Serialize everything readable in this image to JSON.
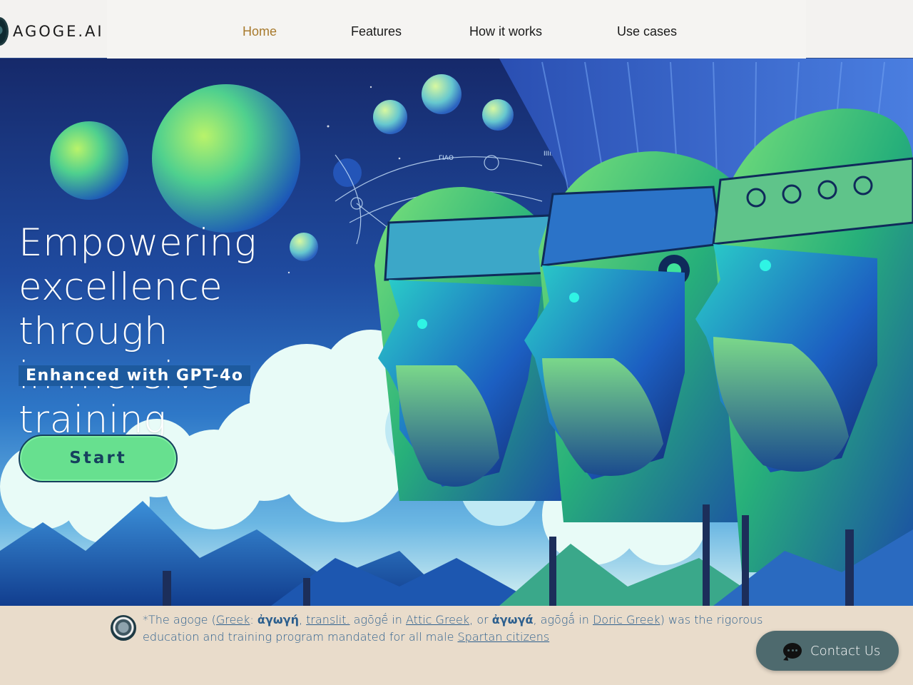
{
  "header": {
    "logo_text": "AGOGE.AI",
    "nav": [
      {
        "label": "Home",
        "active": true
      },
      {
        "label": "Features",
        "active": false
      },
      {
        "label": "How it works",
        "active": false
      },
      {
        "label": "Use cases",
        "active": false
      }
    ]
  },
  "hero": {
    "title": "Empowering excellence through immersive training",
    "badge": "Enhanced with GPT-4o",
    "start_label": "Start",
    "art_labels": [
      "ΓΙΑΟ",
      "ΙΙΙΙΙ"
    ]
  },
  "footer": {
    "note_prefix": "*The agoge (",
    "link_greek": "Greek",
    "sep1": ": ",
    "greek_word": "ἀγωγή",
    "sep2": ", ",
    "link_translit": "translit.",
    "sep3": " agōgḗ in ",
    "link_attic": "Attic Greek",
    "sep4": ", or ",
    "greek_word2": "ἀγωγά",
    "sep5": ", agōgā́ in ",
    "link_doric": "Doric Greek",
    "sep6": ") was the rigorous education and training program mandated for all male ",
    "link_spartan": "Spartan citizens"
  },
  "contact": {
    "label": "Contact Us"
  },
  "colors": {
    "nav_active": "#a87a2d",
    "start_button": "#67e08f",
    "badge_bg": "#1d5a9e",
    "footer_bg": "#e9dccb",
    "contact_bg": "#4e6a6e"
  }
}
